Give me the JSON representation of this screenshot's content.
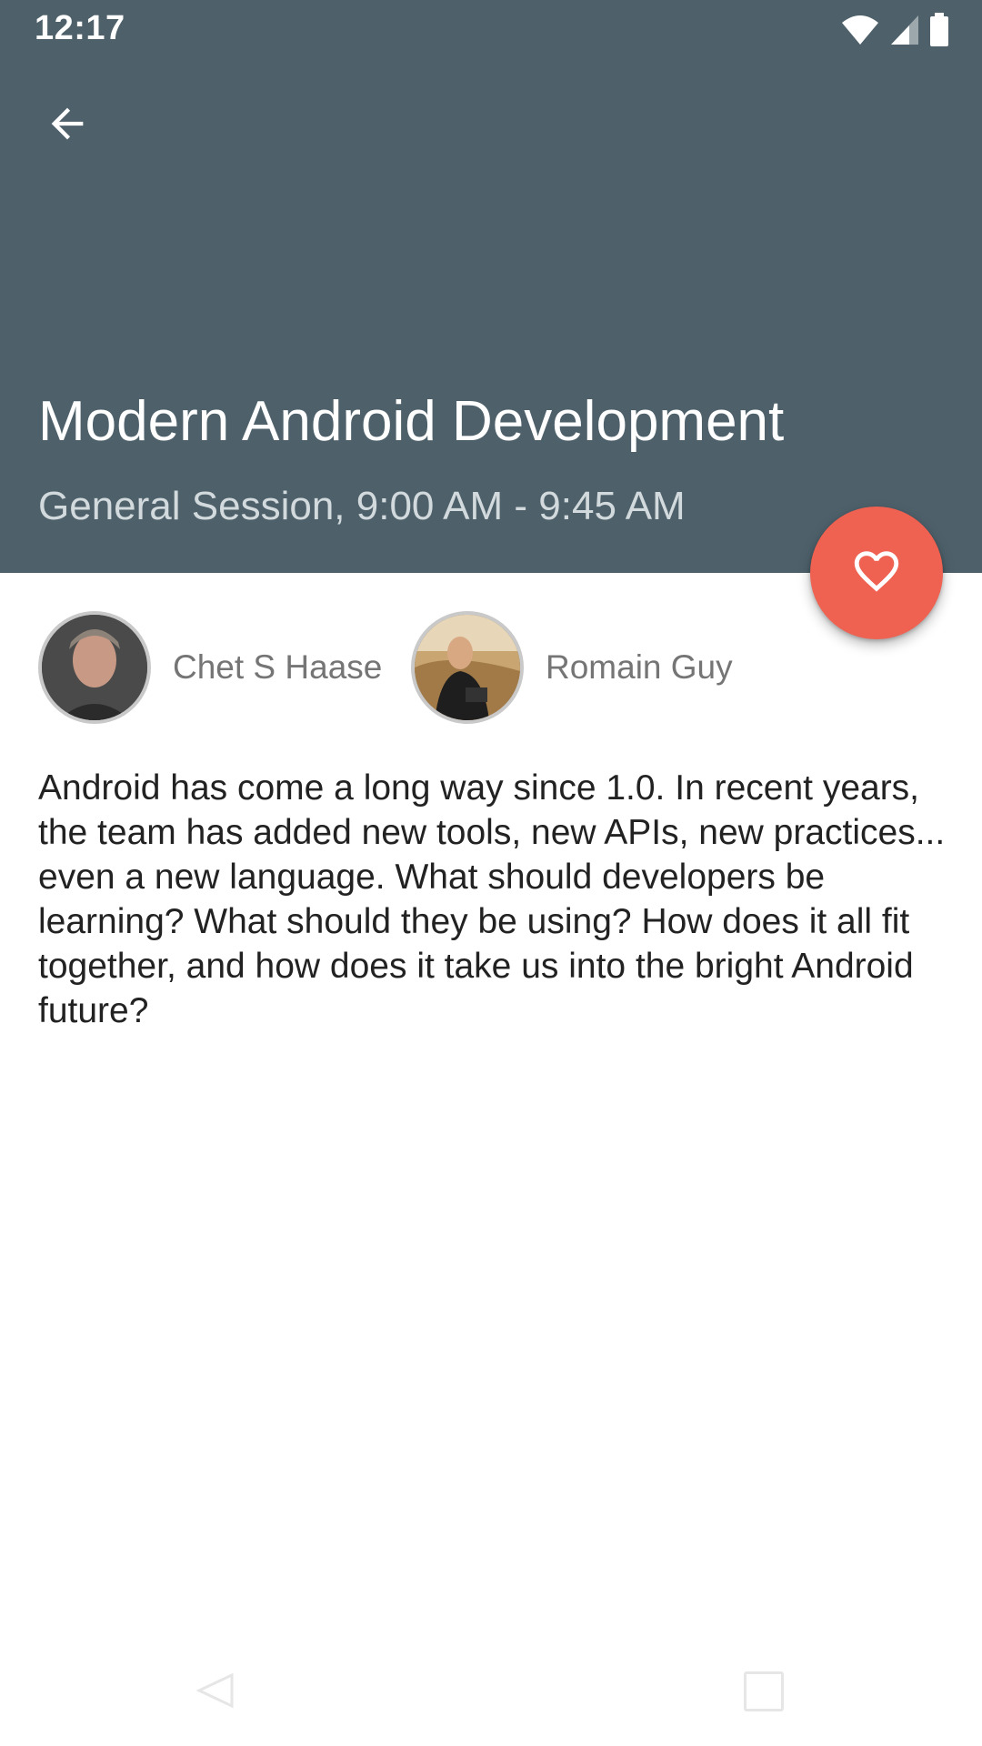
{
  "status_bar": {
    "time": "12:17",
    "icons": [
      "wifi-icon",
      "signal-icon",
      "battery-icon"
    ]
  },
  "header": {
    "back_icon": "arrow-back-icon",
    "title": "Modern Android Development",
    "subtitle": "General Session, 9:00 AM - 9:45 AM",
    "background_color": "#4e616b"
  },
  "fab": {
    "icon": "heart-outline-icon",
    "color": "#ef6150"
  },
  "speakers": [
    {
      "name": "Chet S Haase"
    },
    {
      "name": "Romain Guy"
    }
  ],
  "description": "Android has come a long way since 1.0. In recent years, the team has added new tools, new APIs, new practices... even a new language. What should developers be learning? What should they be using? How does it all fit together, and how does it take us into the bright Android future?",
  "nav_bar": {
    "icons": [
      "nav-back-icon",
      "nav-recents-icon"
    ]
  }
}
